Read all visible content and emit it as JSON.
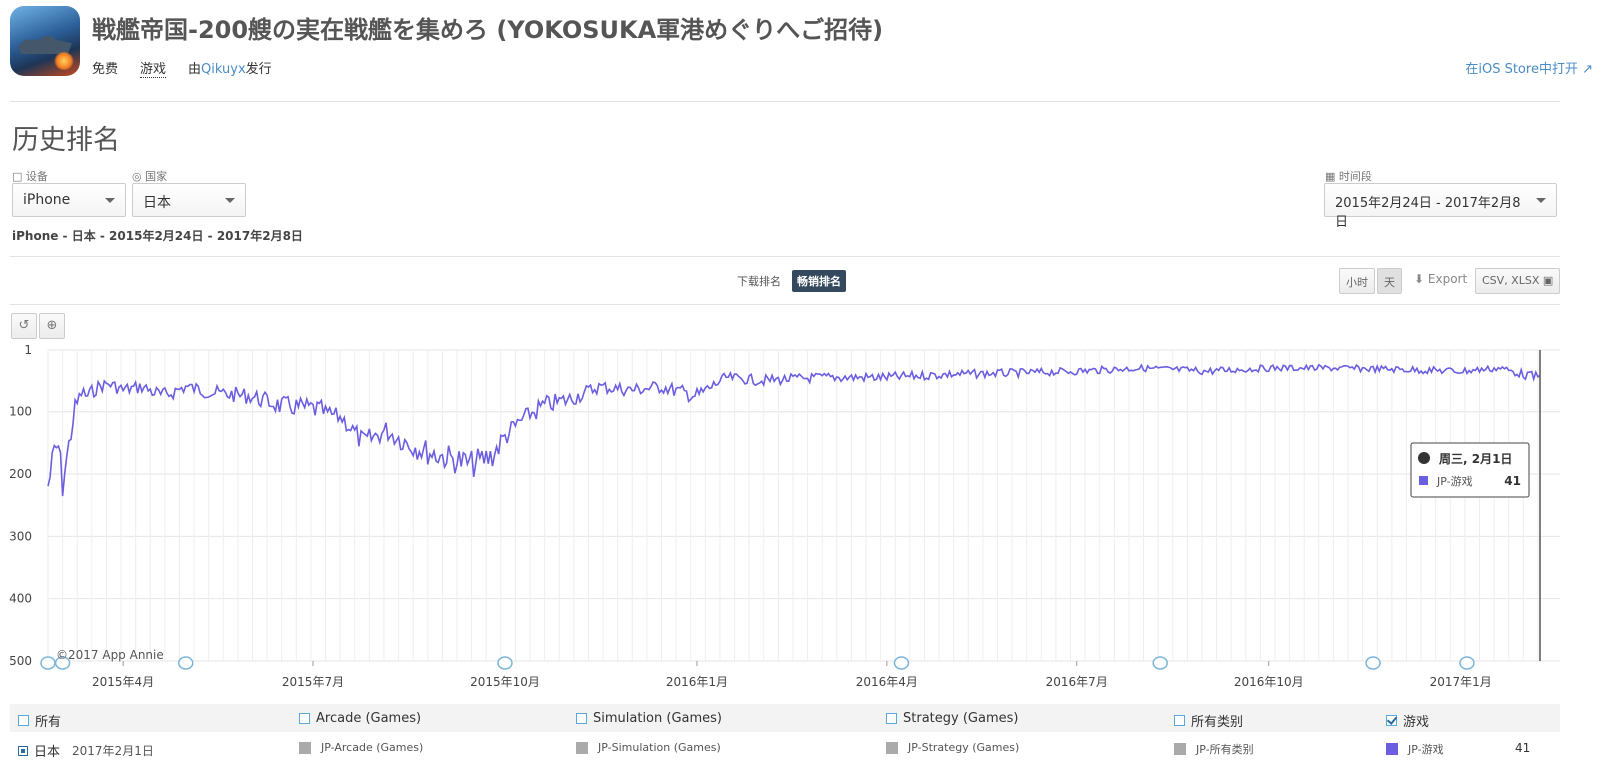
{
  "app": {
    "title": "戦艦帝国-200艘の実在戦艦を集めろ (YOKOSUKA軍港めぐりへご招待)",
    "price": "免费",
    "category": "游戏",
    "publisher_prefix": "由",
    "publisher": "Qikuyx",
    "publisher_suffix": "发行",
    "store_link": "在iOS Store中打开"
  },
  "section_title": "历史排名",
  "filters": {
    "device_label": "设备",
    "device_value": "iPhone",
    "country_label": "国家",
    "country_value": "日本",
    "period_label": "时间段",
    "period_value": "2015年2月24日 - 2017年2月8日"
  },
  "subtitle": "iPhone - 日本 - 2015年2月24日 - 2017年2月8日",
  "rank_tabs": {
    "download": "下载排名",
    "grossing": "畅销排名"
  },
  "controls": {
    "hour": "小时",
    "day": "天",
    "export": "Export",
    "format": "CSV, XLSX"
  },
  "chart_data": {
    "type": "line",
    "x_range": [
      "2015-02-24",
      "2017-02-08"
    ],
    "y_range": [
      1,
      500
    ],
    "y_inverted": true,
    "yticks": [
      1,
      100,
      200,
      300,
      400,
      500
    ],
    "xticks": [
      "2015年4月",
      "2015年7月",
      "2015年10月",
      "2016年1月",
      "2016年4月",
      "2016年7月",
      "2016年10月",
      "2017年1月"
    ],
    "grid": true,
    "series": [
      {
        "name": "JP-游戏",
        "color": "#6b5ee0",
        "points": [
          [
            "2015-02-24",
            220
          ],
          [
            "2015-02-27",
            165
          ],
          [
            "2015-03-01",
            155
          ],
          [
            "2015-03-03",
            215
          ],
          [
            "2015-03-06",
            155
          ],
          [
            "2015-03-09",
            95
          ],
          [
            "2015-03-12",
            70
          ],
          [
            "2015-03-15",
            75
          ],
          [
            "2015-03-20",
            60
          ],
          [
            "2015-03-25",
            55
          ],
          [
            "2015-04-01",
            65
          ],
          [
            "2015-04-10",
            60
          ],
          [
            "2015-04-20",
            75
          ],
          [
            "2015-05-01",
            60
          ],
          [
            "2015-05-15",
            70
          ],
          [
            "2015-06-01",
            75
          ],
          [
            "2015-06-15",
            90
          ],
          [
            "2015-07-01",
            95
          ],
          [
            "2015-07-15",
            110
          ],
          [
            "2015-07-25",
            150
          ],
          [
            "2015-08-05",
            130
          ],
          [
            "2015-08-15",
            150
          ],
          [
            "2015-08-25",
            165
          ],
          [
            "2015-09-05",
            175
          ],
          [
            "2015-09-15",
            185
          ],
          [
            "2015-09-25",
            170
          ],
          [
            "2015-10-01",
            140
          ],
          [
            "2015-10-10",
            110
          ],
          [
            "2015-10-20",
            90
          ],
          [
            "2015-11-01",
            80
          ],
          [
            "2015-11-15",
            60
          ],
          [
            "2015-12-01",
            65
          ],
          [
            "2015-12-15",
            60
          ],
          [
            "2016-01-01",
            75
          ],
          [
            "2016-01-15",
            45
          ],
          [
            "2016-02-01",
            50
          ],
          [
            "2016-03-01",
            45
          ],
          [
            "2016-04-01",
            45
          ],
          [
            "2016-05-01",
            40
          ],
          [
            "2016-06-01",
            38
          ],
          [
            "2016-07-01",
            35
          ],
          [
            "2016-08-01",
            30
          ],
          [
            "2016-09-01",
            35
          ],
          [
            "2016-10-01",
            30
          ],
          [
            "2016-11-01",
            30
          ],
          [
            "2016-12-01",
            32
          ],
          [
            "2017-01-01",
            35
          ],
          [
            "2017-01-20",
            30
          ],
          [
            "2017-02-01",
            41
          ],
          [
            "2017-02-08",
            45
          ]
        ]
      }
    ],
    "markers": [
      "2015-02-24",
      "2015-03-03",
      "2015-05-01",
      "2015-10-01",
      "2016-04-08",
      "2016-08-10",
      "2016-11-20",
      "2017-01-04"
    ],
    "tooltip": {
      "date": "周三, 2月1日",
      "series": "JP-游戏",
      "value": "41"
    },
    "credit": "©2017 App Annie"
  },
  "legend": {
    "categories": [
      {
        "label": "所有",
        "checked": false
      },
      {
        "label": "Arcade (Games)",
        "checked": false
      },
      {
        "label": "Simulation (Games)",
        "checked": false
      },
      {
        "label": "Strategy (Games)",
        "checked": false
      },
      {
        "label": "所有类别",
        "checked": false
      },
      {
        "label": "游戏",
        "checked": true
      }
    ],
    "row": {
      "country": "日本",
      "date": "2017年2月1日",
      "series": [
        {
          "label": "JP-Arcade (Games)",
          "color": "#aaaaaa"
        },
        {
          "label": "JP-Simulation (Games)",
          "color": "#aaaaaa"
        },
        {
          "label": "JP-Strategy (Games)",
          "color": "#aaaaaa"
        },
        {
          "label": "JP-所有类别",
          "color": "#aaaaaa"
        },
        {
          "label": "JP-游戏",
          "color": "#6b5ee0"
        }
      ],
      "value": "41"
    }
  }
}
